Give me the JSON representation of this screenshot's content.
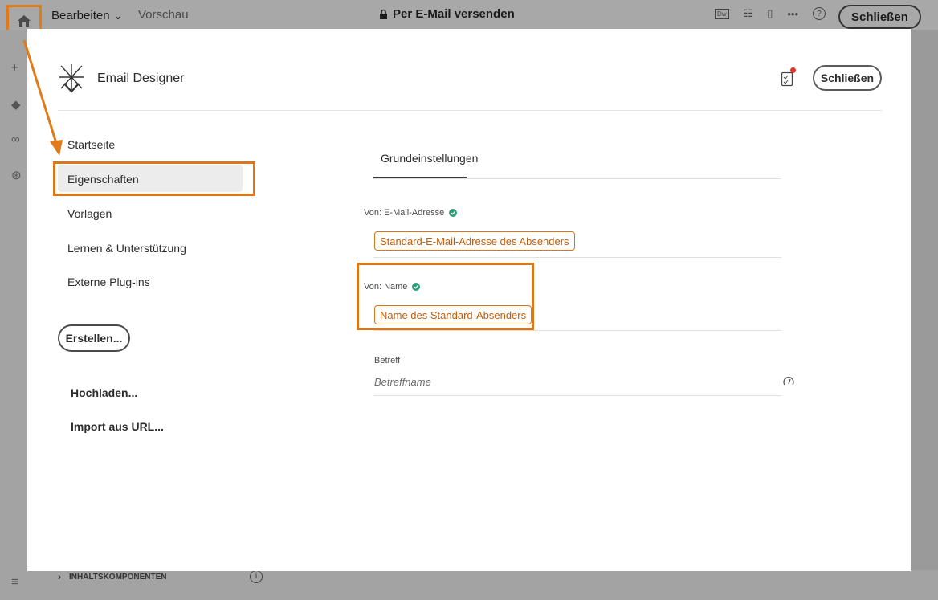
{
  "topbar": {
    "edit_label": "Bearbeiten",
    "preview_label": "Vorschau",
    "title": "Per E-Mail versenden",
    "close_label": "Schließen",
    "more_label": "•••",
    "help_label": "?"
  },
  "bottom": {
    "components_label": "INHALTSKOMPONENTEN",
    "info_label": "i"
  },
  "modal": {
    "app_name": "Email Designer",
    "close_label": "Schließen"
  },
  "nav": {
    "items": [
      {
        "label": "Startseite"
      },
      {
        "label": "Eigenschaften"
      },
      {
        "label": "Vorlagen"
      },
      {
        "label": "Lernen & Unterstützung"
      },
      {
        "label": "Externe Plug-ins"
      }
    ],
    "create_label": "Erstellen...",
    "upload_label": "Hochladen...",
    "import_label": "Import aus URL..."
  },
  "settings": {
    "tab_label": "Grundeinstellungen",
    "from_email_label": "Von: E-Mail-Adresse",
    "from_email_value": "Standard-E-Mail-Adresse des Absenders",
    "from_name_label": "Von: Name",
    "from_name_value": "Name des Standard-Absenders",
    "subject_label": "Betreff",
    "subject_placeholder": "Betreffname"
  },
  "colors": {
    "highlight": "#d9771a",
    "check": "#2d9d78",
    "notification": "#e0352b"
  }
}
